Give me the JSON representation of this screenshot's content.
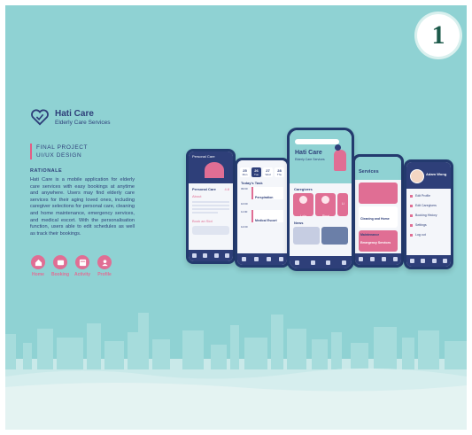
{
  "badge": {
    "number": "1"
  },
  "brand": {
    "name": "Hati Care",
    "tagline": "Elderly Care Services"
  },
  "project": {
    "line1": "FINAL PROJECT",
    "line2": "UI/UX DESIGN"
  },
  "rationale": {
    "heading": "RATIONALE",
    "text": "Hati Care is a mobile application for elderly care services with easy bookings at anytime and anywhere. Users may find elderly care services for their aging loved ones, including caregiver selections for personal care, cleaning and home maintenance, emergency services, and medical escort. With the personalisation function, users able to edit schedules as well as track their bookings."
  },
  "nav": [
    {
      "label": "Home",
      "icon": "home-icon"
    },
    {
      "label": "Booking",
      "icon": "booking-icon"
    },
    {
      "label": "Activity",
      "icon": "activity-icon"
    },
    {
      "label": "Profile",
      "icon": "profile-icon"
    }
  ],
  "phones": {
    "personal": {
      "header": "Personal Care",
      "title": "Personal Care",
      "rating": "4.8",
      "section": "About",
      "section2": "Book an Slot"
    },
    "schedule": {
      "days": [
        {
          "num": "25",
          "d": "Mon"
        },
        {
          "num": "26",
          "d": "Tue"
        },
        {
          "num": "27",
          "d": "Wed"
        },
        {
          "num": "28",
          "d": "Thu"
        }
      ],
      "title": "Today's Task",
      "tasks": [
        {
          "time": "09:00",
          "name": "Perspiration"
        },
        {
          "time": "10:00",
          "name": ""
        },
        {
          "time": "11:00",
          "name": "Medical Escort"
        },
        {
          "time": "12:00",
          "name": ""
        }
      ]
    },
    "home": {
      "title": "Hati Care",
      "subtitle": "Elderly Care Services",
      "categories": "Caregivers",
      "news": "News",
      "names": [
        "Lola",
        "Rinai",
        "Li"
      ]
    },
    "services": {
      "title": "Services",
      "card1": "Cleaning and Home Maintenance",
      "card2": "Emergency Services"
    },
    "profile": {
      "name": "Adam Wong",
      "items": [
        "Edit Profile",
        "Edit Caregivers",
        "Booking History",
        "Settings",
        "Log out"
      ]
    }
  },
  "colors": {
    "background": "#8fd2d3",
    "navy": "#2e3f79",
    "pink": "#e06e94"
  }
}
